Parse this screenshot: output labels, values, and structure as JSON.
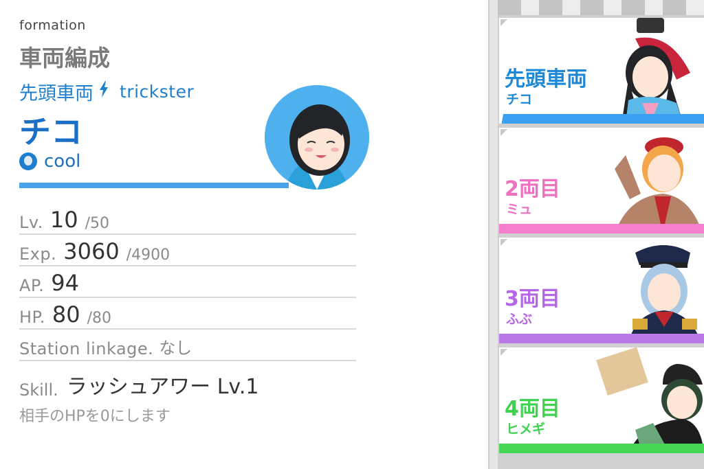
{
  "header": {
    "subtitle": "formation",
    "title": "車両編成"
  },
  "selected": {
    "role": "先頭車両",
    "type": "trickster",
    "name": "チコ",
    "attribute": "cool",
    "attribute_icon": "cool-attribute-icon",
    "role_icon": "lightning-bolt-icon"
  },
  "stats": {
    "lv": {
      "label": "Lv.",
      "value": "10",
      "max": "/50"
    },
    "exp": {
      "label": "Exp.",
      "value": "3060",
      "max": "/4900"
    },
    "ap": {
      "label": "AP.",
      "value": "94"
    },
    "hp": {
      "label": "HP.",
      "value": "80",
      "max": "/80"
    },
    "station": {
      "label": "Station linkage.",
      "value": "なし"
    }
  },
  "skill": {
    "label": "Skill.",
    "name": "ラッシュアワー Lv.1",
    "description": "相手のHPを0にします"
  },
  "formation_cards": [
    {
      "position": "先頭車両",
      "name": "チコ",
      "color": "#1e88d8",
      "stripe": "#3aa0ef"
    },
    {
      "position": "2両目",
      "name": "ミュ",
      "color": "#ef6fc0",
      "stripe": "#f57fcc"
    },
    {
      "position": "3両目",
      "name": "ふぶ",
      "color": "#b466e6",
      "stripe": "#b97ae8"
    },
    {
      "position": "4両目",
      "name": "ヒメギ",
      "color": "#3fd14f",
      "stripe": "#45d655"
    }
  ],
  "colors": {
    "accent_blue": "#1e7fcf",
    "bar_blue": "#4aa3e8"
  }
}
